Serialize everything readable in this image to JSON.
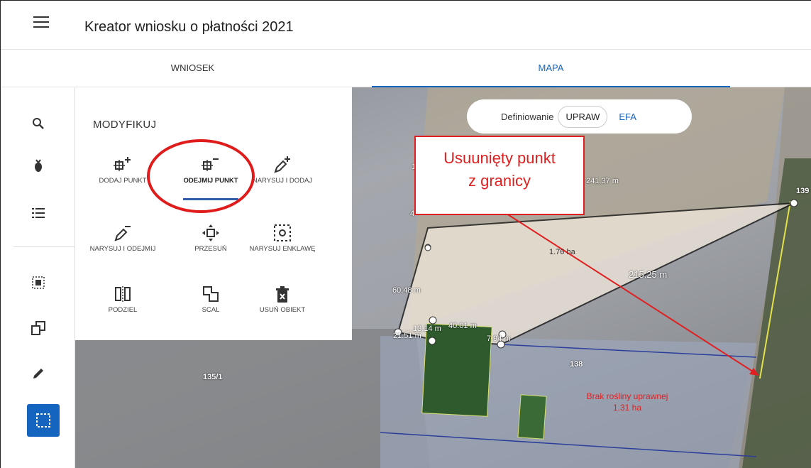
{
  "app": {
    "title": "Kreator wniosku o płatności 2021"
  },
  "tabs": [
    {
      "label": "WNIOSEK"
    },
    {
      "label": "MAPA"
    }
  ],
  "panel": {
    "title": "MODYFIKUJ",
    "tools": [
      {
        "label": "DODAJ PUNKT",
        "icon": "add-point-icon"
      },
      {
        "label": "ODEJMIJ PUNKT",
        "icon": "remove-point-icon",
        "active": true
      },
      {
        "label": "NARYSUJ I DODAJ",
        "icon": "draw-add-icon"
      },
      {
        "label": "NARYSUJ I ODEJMIJ",
        "icon": "draw-subtract-icon"
      },
      {
        "label": "PRZESUŃ",
        "icon": "move-icon"
      },
      {
        "label": "NARYSUJ ENKLAWĘ",
        "icon": "draw-enclave-icon"
      },
      {
        "label": "PODZIEL",
        "icon": "split-icon"
      },
      {
        "label": "SCAL",
        "icon": "merge-icon"
      },
      {
        "label": "USUŃ OBIEKT",
        "icon": "delete-object-icon"
      }
    ]
  },
  "segmented": {
    "label": "Definiowanie",
    "options": [
      "UPRAW",
      "EFA"
    ],
    "selected": "UPRAW"
  },
  "sidebar": {
    "icons": [
      "search-icon",
      "crop-icon",
      "list-icon",
      "select-all-icon",
      "copy-icon",
      "pencil-icon",
      "selection-icon"
    ]
  },
  "annotation": {
    "line1": "Usuunięty punkt",
    "line2": "z granicy"
  },
  "map": {
    "labels": {
      "top_edge": "241.37 m",
      "right_edge": "215.25 m",
      "left_edge": "60.48 m",
      "area": "1.76 ha",
      "parcel_139": "139",
      "parcel_138": "138",
      "parcel_1351": "135/1",
      "seg1": "13.14 m",
      "seg2": "7.94 m",
      "seg3": "21.51 m",
      "seg4": "40.01 m",
      "left_num1": "1",
      "left_num2": "4"
    },
    "note_line1": "Brak rośliny uprawnej",
    "note_line2": "1.31 ha"
  },
  "colors": {
    "accent": "#1565c0",
    "annotation_red": "#e02020",
    "polygon_fill": "#f3e9dd"
  }
}
